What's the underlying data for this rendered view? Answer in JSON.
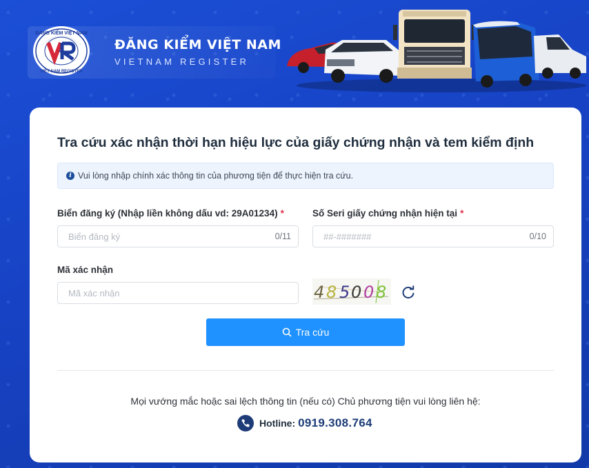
{
  "header": {
    "brand_title": "ĐĂNG KIỂM VIỆT NAM",
    "brand_subtitle": "VIETNAM REGISTER",
    "logo": {
      "top_text": "ĐĂNG KIỂM VIỆT NAM",
      "bottom_text": "VIET NAM REGISTER",
      "mark": "VR"
    }
  },
  "card": {
    "title": "Tra cứu xác nhận thời hạn hiệu lực của giấy chứng nhận và tem kiểm định",
    "alert_text": "Vui lòng nhập chính xác thông tin của phương tiện để thực hiện tra cứu."
  },
  "form": {
    "plate": {
      "label": "Biển đăng ký (Nhập liền không dấu vd: 29A01234)",
      "required_mark": "*",
      "placeholder": "Biển đăng ký",
      "value": "",
      "counter": "0/11"
    },
    "serial": {
      "label": "Số Seri giấy chứng nhận hiện tại",
      "required_mark": "*",
      "placeholder": "##-#######",
      "value": "",
      "counter": "0/10"
    },
    "captcha": {
      "label": "Mã xác nhận",
      "placeholder": "Mã xác nhận",
      "value": "",
      "image_code": "485008"
    },
    "submit_label": "Tra cứu"
  },
  "footer": {
    "contact_note": "Mọi vướng mắc hoặc sai lệch thông tin (nếu có) Chủ phương tiện vui lòng liên hệ:",
    "hotline_label": "Hotline:",
    "hotline_number": "0919.308.764"
  },
  "colors": {
    "background": "#1742c4",
    "primary_button": "#1f92ff",
    "required": "#e0324b",
    "hotline": "#1d3c78"
  },
  "icons": [
    "info-icon",
    "search-icon",
    "refresh-icon",
    "phone-icon"
  ]
}
